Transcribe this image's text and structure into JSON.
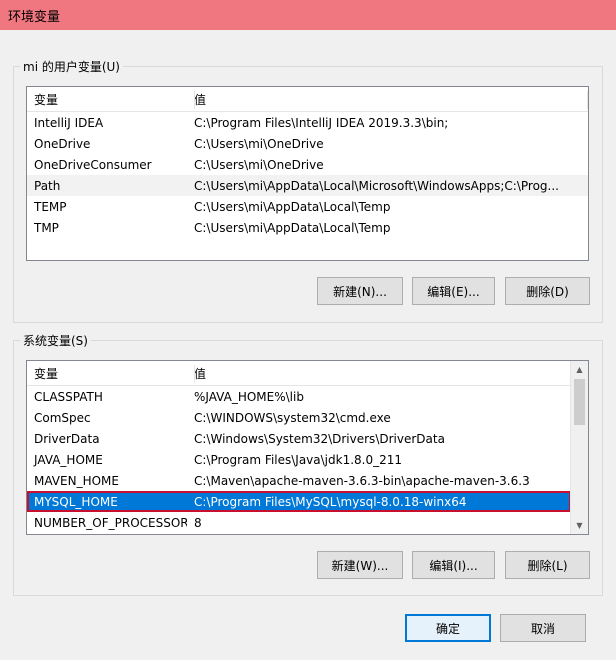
{
  "window": {
    "title": "环境变量"
  },
  "user_vars": {
    "legend": "mi 的用户变量(U)",
    "headers": [
      "变量",
      "值"
    ],
    "rows": [
      {
        "name": "IntelliJ IDEA",
        "value": "C:\\Program Files\\IntelliJ IDEA 2019.3.3\\bin;"
      },
      {
        "name": "OneDrive",
        "value": "C:\\Users\\mi\\OneDrive"
      },
      {
        "name": "OneDriveConsumer",
        "value": "C:\\Users\\mi\\OneDrive"
      },
      {
        "name": "Path",
        "value": "C:\\Users\\mi\\AppData\\Local\\Microsoft\\WindowsApps;C:\\Prog..."
      },
      {
        "name": "TEMP",
        "value": "C:\\Users\\mi\\AppData\\Local\\Temp"
      },
      {
        "name": "TMP",
        "value": "C:\\Users\\mi\\AppData\\Local\\Temp"
      }
    ],
    "buttons": {
      "new": "新建(N)...",
      "edit": "编辑(E)...",
      "delete": "删除(D)"
    }
  },
  "sys_vars": {
    "legend": "系统变量(S)",
    "headers": [
      "变量",
      "值"
    ],
    "rows": [
      {
        "name": "CLASSPATH",
        "value": "%JAVA_HOME%\\lib"
      },
      {
        "name": "ComSpec",
        "value": "C:\\WINDOWS\\system32\\cmd.exe"
      },
      {
        "name": "DriverData",
        "value": "C:\\Windows\\System32\\Drivers\\DriverData"
      },
      {
        "name": "JAVA_HOME",
        "value": "C:\\Program Files\\Java\\jdk1.8.0_211"
      },
      {
        "name": "MAVEN_HOME",
        "value": "C:\\Maven\\apache-maven-3.6.3-bin\\apache-maven-3.6.3"
      },
      {
        "name": "MYSQL_HOME",
        "value": "C:\\Program Files\\MySQL\\mysql-8.0.18-winx64"
      },
      {
        "name": "NUMBER_OF_PROCESSORS",
        "value": "8"
      }
    ],
    "buttons": {
      "new": "新建(W)...",
      "edit": "编辑(I)...",
      "delete": "删除(L)"
    }
  },
  "dialog_buttons": {
    "ok": "确定",
    "cancel": "取消"
  },
  "icons": {
    "scroll_up": "scroll-up-arrow-icon",
    "scroll_down": "scroll-down-arrow-icon"
  },
  "colors": {
    "titlebar": "#f0767f",
    "selection": "#0078d7",
    "highlight_border": "#c8102e"
  }
}
